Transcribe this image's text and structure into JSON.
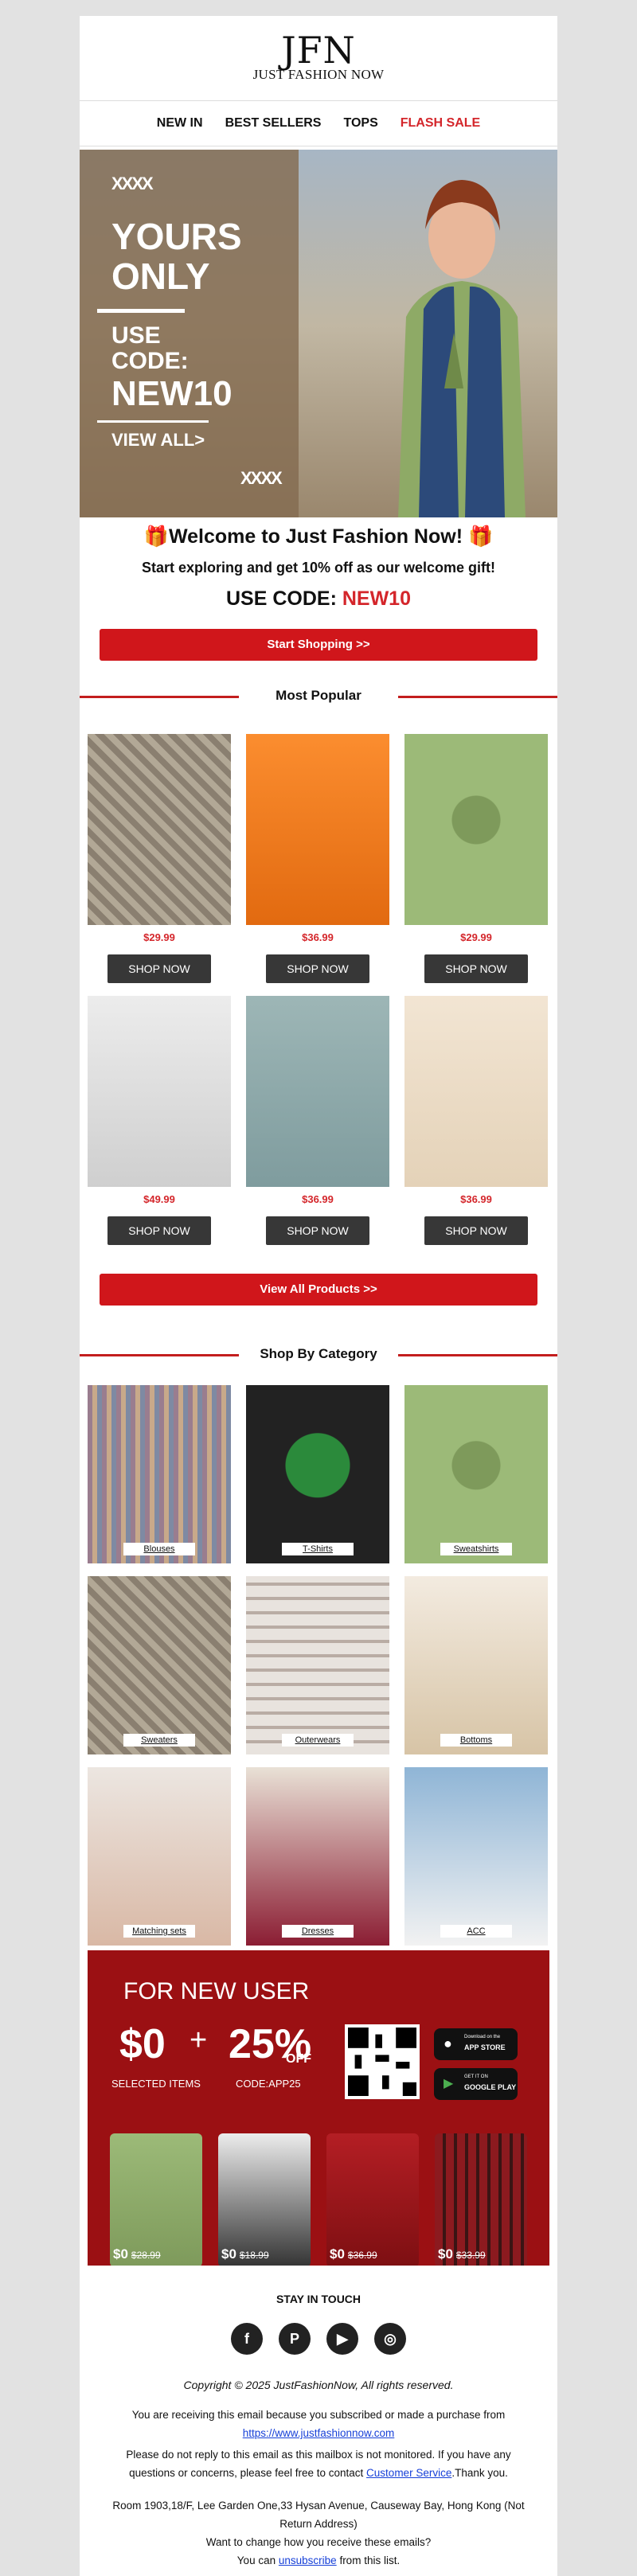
{
  "brand": {
    "logo_mark": "JFN",
    "logo_sub": "JUST FASHION NOW"
  },
  "nav": {
    "new_in": "NEW IN",
    "best_sellers": "BEST SELLERS",
    "tops": "TOPS",
    "flash_sale": "FLASH SALE"
  },
  "hero": {
    "deco": "XXXX",
    "line1": "YOURS",
    "line2": "ONLY",
    "use": "USE",
    "code_label": "CODE:",
    "code": "NEW10",
    "view_all": "VIEW ALL>"
  },
  "welcome": {
    "title": "🎁Welcome to Just Fashion Now! 🎁",
    "sub": "Start exploring and get 10% off as our welcome gift!",
    "use_code": "USE CODE:",
    "code": "NEW10"
  },
  "buttons": {
    "start_shopping": "Start Shopping >>",
    "view_all": "View All Products >>",
    "shop_now": "SHOP NOW"
  },
  "sections": {
    "popular": "Most Popular",
    "category": "Shop By Category"
  },
  "popular": [
    {
      "price": "$29.99"
    },
    {
      "price": "$36.99"
    },
    {
      "price": "$29.99"
    },
    {
      "price": "$49.99"
    },
    {
      "price": "$36.99"
    },
    {
      "price": "$36.99"
    }
  ],
  "categories": [
    "Blouses",
    "T-Shirts",
    "Sweatshirts",
    "Sweaters",
    "Outerwears",
    "Bottoms",
    "Matching sets",
    "Dresses",
    "ACC"
  ],
  "promo": {
    "title": "FOR NEW USER",
    "zero": "$0",
    "plus": "+",
    "pct": "25%",
    "off": "OFF",
    "selected": "SELECTED ITEMS",
    "code": "CODE:APP25",
    "app_store_top": "Download on the",
    "app_store": "APP STORE",
    "google_top": "GET IT ON",
    "google": "GOOGLE PLAY",
    "items": [
      {
        "now": "$0",
        "was": "$28.99"
      },
      {
        "now": "$0",
        "was": "$18.99"
      },
      {
        "now": "$0",
        "was": "$36.99"
      },
      {
        "now": "$0",
        "was": "$33.99"
      }
    ]
  },
  "footer": {
    "stay": "STAY IN TOUCH",
    "copyright": "Copyright © 2025 JustFashionNow, All rights reserved.",
    "receiving": "You are receiving this email because you subscribed or made a purchase from",
    "site": "https://www.justfashionnow.com",
    "noreply": "Please do not reply to this email as this mailbox is not monitored. If you have any questions or concerns, please feel free to contact",
    "cs": "Customer Service",
    "thanks": ".Thank you.",
    "address": "Room 1903,18/F, Lee Garden One,33 Hysan Avenue, Causeway Bay, Hong Kong (Not Return Address)",
    "change": "Want to change how you receive these emails?",
    "can": "You can",
    "unsub": "unsubscribe",
    "from": "from this list."
  }
}
